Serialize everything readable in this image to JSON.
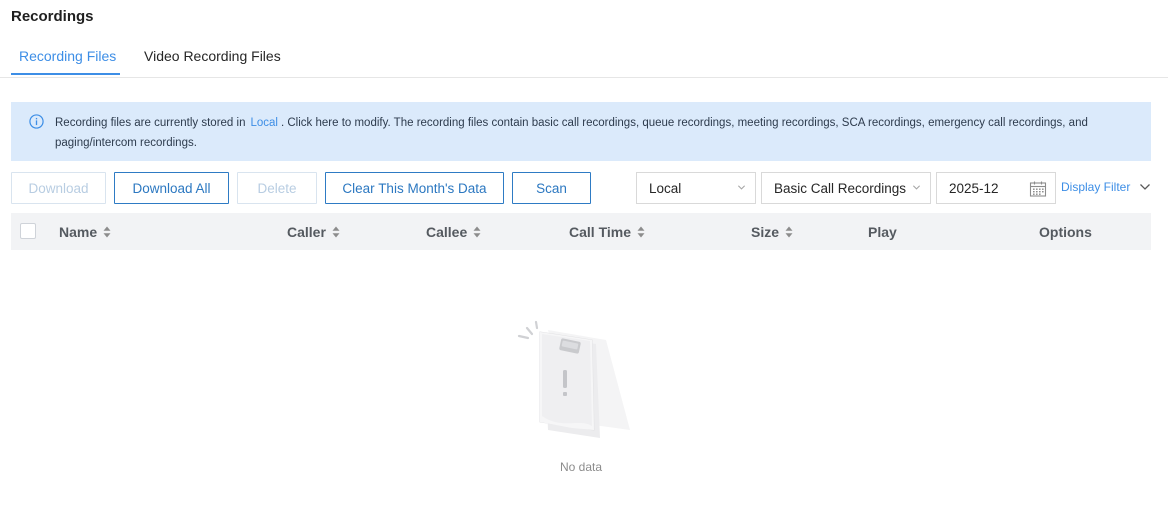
{
  "page": {
    "title": "Recordings"
  },
  "tabs": [
    {
      "label": "Recording Files",
      "active": true
    },
    {
      "label": "Video Recording Files",
      "active": false
    }
  ],
  "banner": {
    "icon": "info-icon",
    "text_before": "Recording files are currently stored in",
    "link": "Local",
    "text_after": ". Click here to modify. The recording files contain basic call recordings, queue recordings, meeting recordings, SCA recordings, emergency call recordings, and paging/intercom recordings."
  },
  "toolbar": {
    "download": "Download",
    "download_all": "Download All",
    "delete": "Delete",
    "clear_month": "Clear This Month's Data",
    "scan": "Scan",
    "storage_select": "Local",
    "type_select": "Basic Call Recordings",
    "month_value": "2025-12",
    "display_filter": "Display Filter"
  },
  "table": {
    "columns": [
      "Name",
      "Caller",
      "Callee",
      "Call Time",
      "Size",
      "Play",
      "Options"
    ]
  },
  "empty": {
    "text": "No data"
  },
  "colors": {
    "accent": "#3d8ee6",
    "banner_bg": "#dbeafb",
    "header_bg": "#f2f3f5"
  }
}
